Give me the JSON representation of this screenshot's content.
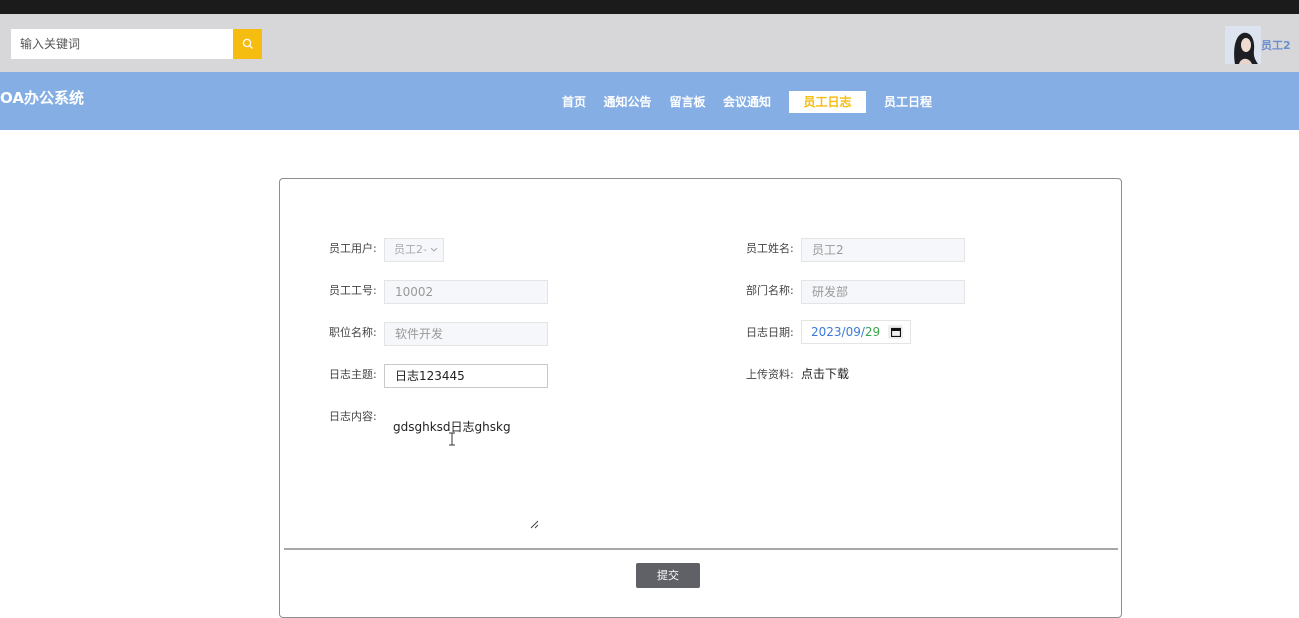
{
  "search": {
    "placeholder": "输入关键词"
  },
  "user": {
    "name": "员工2"
  },
  "brand": "OA办公系统",
  "nav": [
    {
      "label": "首页",
      "active": false
    },
    {
      "label": "通知公告",
      "active": false
    },
    {
      "label": "留言板",
      "active": false
    },
    {
      "label": "会议通知",
      "active": false
    },
    {
      "label": "员工日志",
      "active": true
    },
    {
      "label": "员工日程",
      "active": false
    }
  ],
  "form": {
    "employee_user": {
      "label": "员工用户:",
      "value": "员工2-"
    },
    "employee_name": {
      "label": "员工姓名:",
      "value": "员工2"
    },
    "employee_no": {
      "label": "员工工号:",
      "value": "10002"
    },
    "department": {
      "label": "部门名称:",
      "value": "研发部"
    },
    "position": {
      "label": "职位名称:",
      "value": "软件开发"
    },
    "log_date": {
      "label": "日志日期:",
      "year": "2023",
      "month": "09",
      "day": "29"
    },
    "log_subject": {
      "label": "日志主题:",
      "value": "日志123445"
    },
    "upload": {
      "label": "上传资料:",
      "link": "点击下载"
    },
    "log_content": {
      "label": "日志内容:",
      "value": "gdsghksd日志ghskg"
    },
    "submit_label": "提交"
  },
  "colors": {
    "accent": "#f5bd0f",
    "navbar": "#84aee4",
    "topbar": "#d7d7d9",
    "submit": "#5f6166"
  }
}
